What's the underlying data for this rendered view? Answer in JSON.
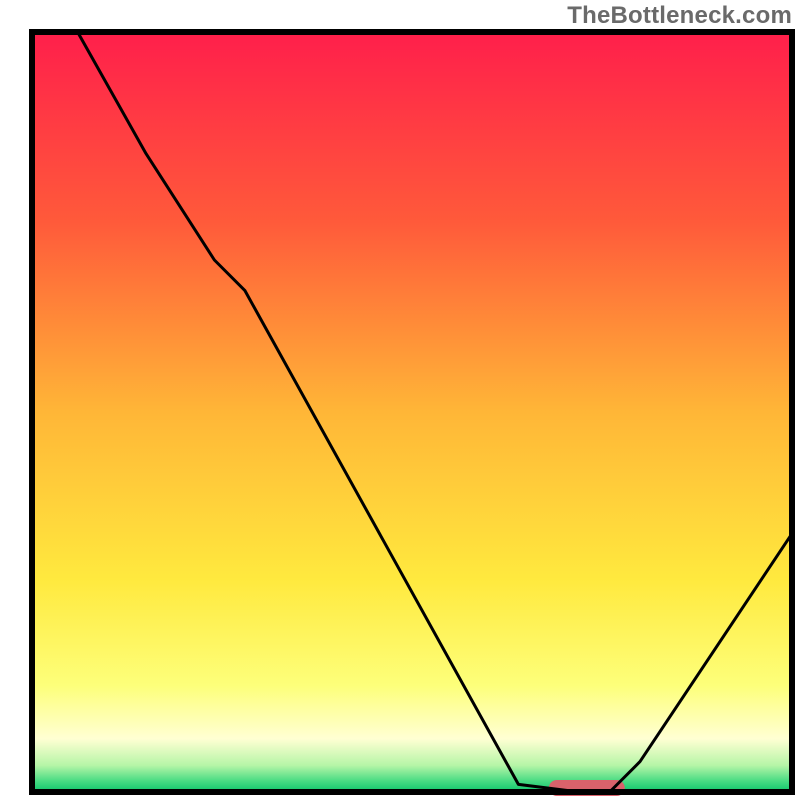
{
  "watermark": "TheBottleneck.com",
  "chart_data": {
    "type": "line",
    "title": "",
    "xlabel": "",
    "ylabel": "",
    "xlim": [
      0,
      100
    ],
    "ylim": [
      0,
      100
    ],
    "series": [
      {
        "name": "bottleneck-curve",
        "x": [
          6,
          15,
          24,
          28,
          64,
          72,
          76,
          80,
          100
        ],
        "y": [
          100,
          84,
          70,
          66,
          1,
          0,
          0,
          4,
          34
        ]
      }
    ],
    "marker": {
      "x_start": 68,
      "x_end": 78,
      "y": 0
    },
    "gradient_stops": [
      {
        "offset": 0.0,
        "color": "#ff1f4b"
      },
      {
        "offset": 0.25,
        "color": "#ff5a3a"
      },
      {
        "offset": 0.5,
        "color": "#ffb637"
      },
      {
        "offset": 0.72,
        "color": "#ffe93e"
      },
      {
        "offset": 0.86,
        "color": "#fdff7a"
      },
      {
        "offset": 0.93,
        "color": "#ffffd3"
      },
      {
        "offset": 0.965,
        "color": "#b6f5a7"
      },
      {
        "offset": 0.985,
        "color": "#4bdc84"
      },
      {
        "offset": 1.0,
        "color": "#0dc46b"
      }
    ],
    "frame_color": "#000000",
    "curve_color": "#000000",
    "marker_color": "#d9626b"
  }
}
